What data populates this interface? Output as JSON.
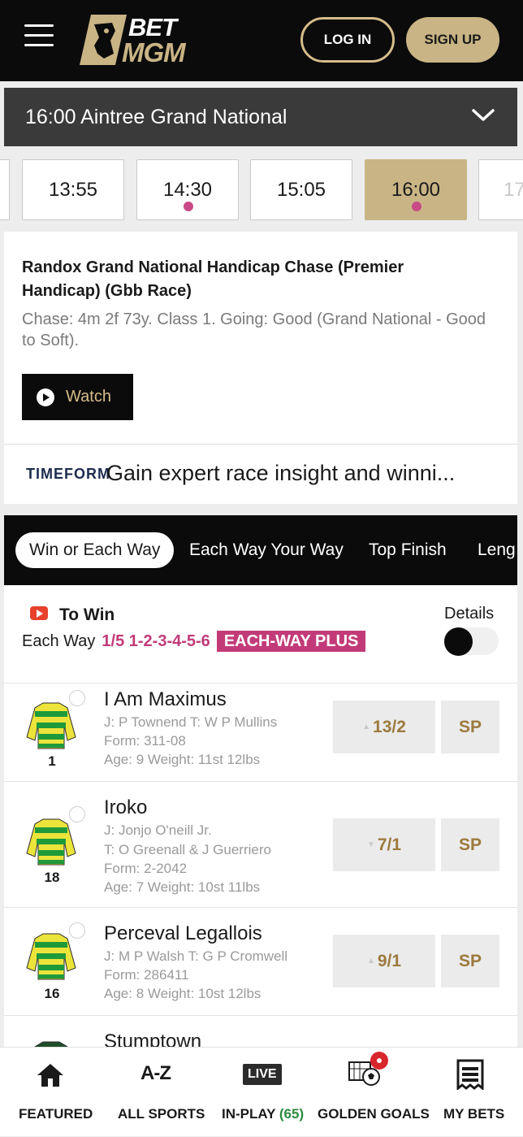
{
  "header": {
    "logo_top": "BET",
    "logo_bottom": "MGM",
    "login_label": "LOG IN",
    "signup_label": "SIGN UP"
  },
  "race_selector": {
    "selected": "16:00 Aintree Grand National",
    "times": [
      {
        "label": "13:55",
        "active": false,
        "live_dot": false
      },
      {
        "label": "14:30",
        "active": false,
        "live_dot": true
      },
      {
        "label": "15:05",
        "active": false,
        "live_dot": false
      },
      {
        "label": "16:00",
        "active": true,
        "live_dot": true
      },
      {
        "label": "17",
        "active": false,
        "live_dot": false
      }
    ]
  },
  "race": {
    "title": "Randox Grand National Handicap Chase (Premier Handicap) (Gbb Race)",
    "description": "Chase: 4m 2f 73y. Class 1. Going: Good (Grand National - Good to Soft).",
    "watch_label": "Watch",
    "timeform_logo": "TIMEFORM",
    "timeform_text": "Gain expert race insight and winni..."
  },
  "tabs": [
    "Win or Each Way",
    "Each Way Your Way",
    "Top Finish",
    "Leng"
  ],
  "market": {
    "title": "To Win",
    "each_way_label": "Each Way",
    "each_way_terms": "1/5 1-2-3-4-5-6",
    "each_way_plus": "EACH-WAY PLUS",
    "details_label": "Details",
    "details_on": false
  },
  "runners": [
    {
      "number": "1",
      "name": "I Am Maximus",
      "lines": [
        "J: P Townend T: W P Mullins",
        "Form: 311-08",
        "Age: 9 Weight: 11st 12lbs"
      ],
      "price": "13/2",
      "trend": "up",
      "sp": "SP"
    },
    {
      "number": "18",
      "name": "Iroko",
      "lines": [
        "J: Jonjo O'neill Jr.",
        "T: O Greenall & J Guerriero",
        "Form: 2-2042",
        "Age: 7 Weight: 10st 11lbs"
      ],
      "price": "7/1",
      "trend": "down",
      "sp": "SP"
    },
    {
      "number": "16",
      "name": "Perceval Legallois",
      "lines": [
        "J: M P Walsh T: G P Cromwell",
        "Form: 286411",
        "Age: 8 Weight: 10st 12lbs"
      ],
      "price": "9/1",
      "trend": "up",
      "sp": "SP"
    },
    {
      "number": "",
      "name": "Stumptown",
      "lines": [],
      "price": "",
      "trend": "",
      "sp": ""
    }
  ],
  "bottom_nav": {
    "featured": "FEATURED",
    "all_sports": "ALL SPORTS",
    "in_play": "IN-PLAY",
    "in_play_count": "(65)",
    "golden_goals": "GOLDEN GOALS",
    "my_bets": "MY BETS",
    "az_icon_text": "A-Z",
    "live_icon_text": "LIVE"
  },
  "colors": {
    "gold": "#c9b485",
    "pink": "#c23b78",
    "dark": "#0b0b0b",
    "price_text": "#9c7a3e",
    "notification_red": "#d9262d"
  }
}
